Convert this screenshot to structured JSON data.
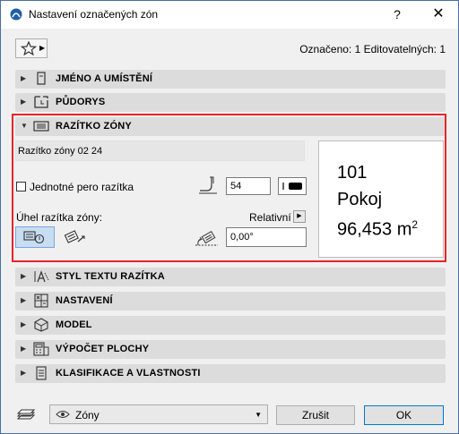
{
  "window": {
    "title": "Nastavení označených zón",
    "help_label": "?",
    "close_label": "✕"
  },
  "header": {
    "marked_text": "Označeno: 1 Editovatelných: 1",
    "favorites_icon": "star-icon"
  },
  "sections": {
    "name": {
      "label": "JMÉNO A UMÍSTĚNÍ",
      "icon": "name-position-icon"
    },
    "floorplan": {
      "label": "PŮDORYS",
      "icon": "floorplan-icon"
    },
    "stamp": {
      "label": "RAZÍTKO ZÓNY",
      "icon": "zone-stamp-icon"
    },
    "text_style": {
      "label": "STYL TEXTU RAZÍTKA",
      "icon": "text-style-icon"
    },
    "settings": {
      "label": "NASTAVENÍ",
      "icon": "settings-icon"
    },
    "model": {
      "label": "MODEL",
      "icon": "model-icon"
    },
    "area": {
      "label": "VÝPOČET PLOCHY",
      "icon": "area-calc-icon"
    },
    "classification": {
      "label": "KLASIFIKACE A VLASTNOSTI",
      "icon": "classification-icon"
    }
  },
  "stamp": {
    "stamp_name": "Razítko zóny 02 24",
    "uniform_pen_label": "Jednotné pero razítka",
    "uniform_pen_checked": false,
    "pen_value": "54",
    "angle_label": "Úhel razítka zóny:",
    "relative_label": "Relativní",
    "angle_value": "0,00°",
    "preview": {
      "number": "101",
      "name": "Pokoj",
      "area": "96,453 m",
      "area_sup": "2"
    }
  },
  "footer": {
    "layer_value": "Zóny",
    "cancel_label": "Zrušit",
    "ok_label": "OK"
  },
  "colors": {
    "highlight_border": "#e8242c",
    "section_bg": "#dcdcdc",
    "selected_btn_bg": "#c8dcf2"
  }
}
